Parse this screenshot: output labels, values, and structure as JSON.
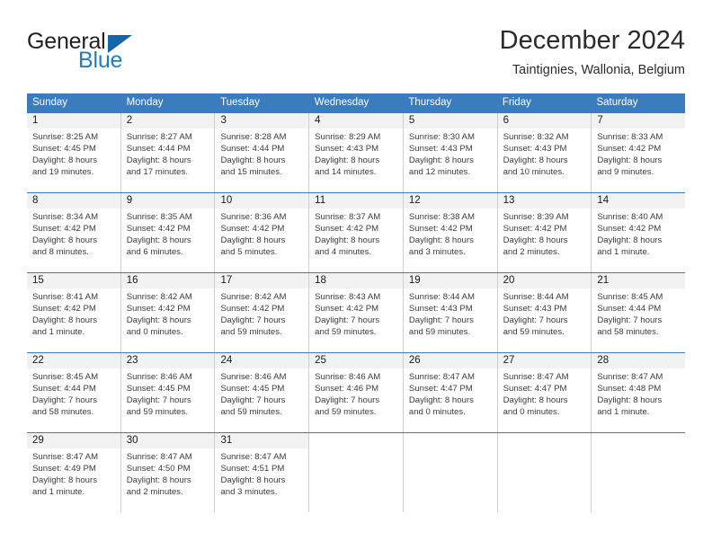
{
  "brand": {
    "name_part1": "General",
    "name_part2": "Blue",
    "triangle_color": "#1565a8",
    "blue_text_color": "#1c7fc4"
  },
  "header": {
    "month_title": "December 2024",
    "location": "Taintignies, Wallonia, Belgium"
  },
  "theme": {
    "header_blue": "#3a7cbe",
    "daynum_band": "#f2f2f2",
    "cell_border": "#cfcfcf"
  },
  "weekdays": [
    "Sunday",
    "Monday",
    "Tuesday",
    "Wednesday",
    "Thursday",
    "Friday",
    "Saturday"
  ],
  "weeks": [
    [
      {
        "day": "1",
        "sunrise": "Sunrise: 8:25 AM",
        "sunset": "Sunset: 4:45 PM",
        "daylight_line1": "Daylight: 8 hours",
        "daylight_line2": "and 19 minutes."
      },
      {
        "day": "2",
        "sunrise": "Sunrise: 8:27 AM",
        "sunset": "Sunset: 4:44 PM",
        "daylight_line1": "Daylight: 8 hours",
        "daylight_line2": "and 17 minutes."
      },
      {
        "day": "3",
        "sunrise": "Sunrise: 8:28 AM",
        "sunset": "Sunset: 4:44 PM",
        "daylight_line1": "Daylight: 8 hours",
        "daylight_line2": "and 15 minutes."
      },
      {
        "day": "4",
        "sunrise": "Sunrise: 8:29 AM",
        "sunset": "Sunset: 4:43 PM",
        "daylight_line1": "Daylight: 8 hours",
        "daylight_line2": "and 14 minutes."
      },
      {
        "day": "5",
        "sunrise": "Sunrise: 8:30 AM",
        "sunset": "Sunset: 4:43 PM",
        "daylight_line1": "Daylight: 8 hours",
        "daylight_line2": "and 12 minutes."
      },
      {
        "day": "6",
        "sunrise": "Sunrise: 8:32 AM",
        "sunset": "Sunset: 4:43 PM",
        "daylight_line1": "Daylight: 8 hours",
        "daylight_line2": "and 10 minutes."
      },
      {
        "day": "7",
        "sunrise": "Sunrise: 8:33 AM",
        "sunset": "Sunset: 4:42 PM",
        "daylight_line1": "Daylight: 8 hours",
        "daylight_line2": "and 9 minutes."
      }
    ],
    [
      {
        "day": "8",
        "sunrise": "Sunrise: 8:34 AM",
        "sunset": "Sunset: 4:42 PM",
        "daylight_line1": "Daylight: 8 hours",
        "daylight_line2": "and 8 minutes."
      },
      {
        "day": "9",
        "sunrise": "Sunrise: 8:35 AM",
        "sunset": "Sunset: 4:42 PM",
        "daylight_line1": "Daylight: 8 hours",
        "daylight_line2": "and 6 minutes."
      },
      {
        "day": "10",
        "sunrise": "Sunrise: 8:36 AM",
        "sunset": "Sunset: 4:42 PM",
        "daylight_line1": "Daylight: 8 hours",
        "daylight_line2": "and 5 minutes."
      },
      {
        "day": "11",
        "sunrise": "Sunrise: 8:37 AM",
        "sunset": "Sunset: 4:42 PM",
        "daylight_line1": "Daylight: 8 hours",
        "daylight_line2": "and 4 minutes."
      },
      {
        "day": "12",
        "sunrise": "Sunrise: 8:38 AM",
        "sunset": "Sunset: 4:42 PM",
        "daylight_line1": "Daylight: 8 hours",
        "daylight_line2": "and 3 minutes."
      },
      {
        "day": "13",
        "sunrise": "Sunrise: 8:39 AM",
        "sunset": "Sunset: 4:42 PM",
        "daylight_line1": "Daylight: 8 hours",
        "daylight_line2": "and 2 minutes."
      },
      {
        "day": "14",
        "sunrise": "Sunrise: 8:40 AM",
        "sunset": "Sunset: 4:42 PM",
        "daylight_line1": "Daylight: 8 hours",
        "daylight_line2": "and 1 minute."
      }
    ],
    [
      {
        "day": "15",
        "sunrise": "Sunrise: 8:41 AM",
        "sunset": "Sunset: 4:42 PM",
        "daylight_line1": "Daylight: 8 hours",
        "daylight_line2": "and 1 minute."
      },
      {
        "day": "16",
        "sunrise": "Sunrise: 8:42 AM",
        "sunset": "Sunset: 4:42 PM",
        "daylight_line1": "Daylight: 8 hours",
        "daylight_line2": "and 0 minutes."
      },
      {
        "day": "17",
        "sunrise": "Sunrise: 8:42 AM",
        "sunset": "Sunset: 4:42 PM",
        "daylight_line1": "Daylight: 7 hours",
        "daylight_line2": "and 59 minutes."
      },
      {
        "day": "18",
        "sunrise": "Sunrise: 8:43 AM",
        "sunset": "Sunset: 4:42 PM",
        "daylight_line1": "Daylight: 7 hours",
        "daylight_line2": "and 59 minutes."
      },
      {
        "day": "19",
        "sunrise": "Sunrise: 8:44 AM",
        "sunset": "Sunset: 4:43 PM",
        "daylight_line1": "Daylight: 7 hours",
        "daylight_line2": "and 59 minutes."
      },
      {
        "day": "20",
        "sunrise": "Sunrise: 8:44 AM",
        "sunset": "Sunset: 4:43 PM",
        "daylight_line1": "Daylight: 7 hours",
        "daylight_line2": "and 59 minutes."
      },
      {
        "day": "21",
        "sunrise": "Sunrise: 8:45 AM",
        "sunset": "Sunset: 4:44 PM",
        "daylight_line1": "Daylight: 7 hours",
        "daylight_line2": "and 58 minutes."
      }
    ],
    [
      {
        "day": "22",
        "sunrise": "Sunrise: 8:45 AM",
        "sunset": "Sunset: 4:44 PM",
        "daylight_line1": "Daylight: 7 hours",
        "daylight_line2": "and 58 minutes."
      },
      {
        "day": "23",
        "sunrise": "Sunrise: 8:46 AM",
        "sunset": "Sunset: 4:45 PM",
        "daylight_line1": "Daylight: 7 hours",
        "daylight_line2": "and 59 minutes."
      },
      {
        "day": "24",
        "sunrise": "Sunrise: 8:46 AM",
        "sunset": "Sunset: 4:45 PM",
        "daylight_line1": "Daylight: 7 hours",
        "daylight_line2": "and 59 minutes."
      },
      {
        "day": "25",
        "sunrise": "Sunrise: 8:46 AM",
        "sunset": "Sunset: 4:46 PM",
        "daylight_line1": "Daylight: 7 hours",
        "daylight_line2": "and 59 minutes."
      },
      {
        "day": "26",
        "sunrise": "Sunrise: 8:47 AM",
        "sunset": "Sunset: 4:47 PM",
        "daylight_line1": "Daylight: 8 hours",
        "daylight_line2": "and 0 minutes."
      },
      {
        "day": "27",
        "sunrise": "Sunrise: 8:47 AM",
        "sunset": "Sunset: 4:47 PM",
        "daylight_line1": "Daylight: 8 hours",
        "daylight_line2": "and 0 minutes."
      },
      {
        "day": "28",
        "sunrise": "Sunrise: 8:47 AM",
        "sunset": "Sunset: 4:48 PM",
        "daylight_line1": "Daylight: 8 hours",
        "daylight_line2": "and 1 minute."
      }
    ],
    [
      {
        "day": "29",
        "sunrise": "Sunrise: 8:47 AM",
        "sunset": "Sunset: 4:49 PM",
        "daylight_line1": "Daylight: 8 hours",
        "daylight_line2": "and 1 minute."
      },
      {
        "day": "30",
        "sunrise": "Sunrise: 8:47 AM",
        "sunset": "Sunset: 4:50 PM",
        "daylight_line1": "Daylight: 8 hours",
        "daylight_line2": "and 2 minutes."
      },
      {
        "day": "31",
        "sunrise": "Sunrise: 8:47 AM",
        "sunset": "Sunset: 4:51 PM",
        "daylight_line1": "Daylight: 8 hours",
        "daylight_line2": "and 3 minutes."
      },
      {
        "day": "",
        "sunrise": "",
        "sunset": "",
        "daylight_line1": "",
        "daylight_line2": ""
      },
      {
        "day": "",
        "sunrise": "",
        "sunset": "",
        "daylight_line1": "",
        "daylight_line2": ""
      },
      {
        "day": "",
        "sunrise": "",
        "sunset": "",
        "daylight_line1": "",
        "daylight_line2": ""
      },
      {
        "day": "",
        "sunrise": "",
        "sunset": "",
        "daylight_line1": "",
        "daylight_line2": ""
      }
    ]
  ]
}
